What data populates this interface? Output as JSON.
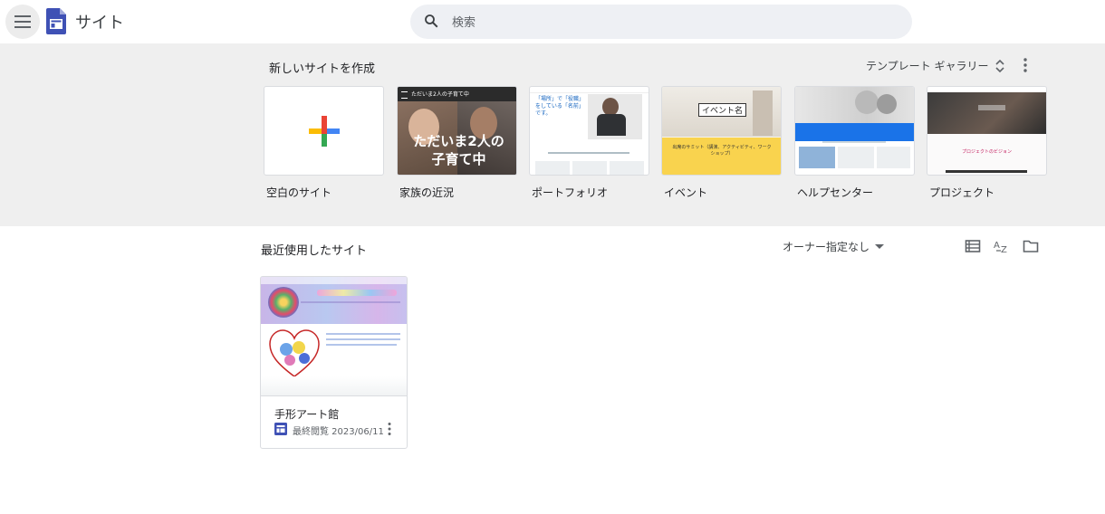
{
  "header": {
    "app_title": "サイト",
    "search_placeholder": "検索"
  },
  "gallery": {
    "title": "新しいサイトを作成",
    "toggle_label": "テンプレート ギャラリー",
    "templates": [
      {
        "label": "空白のサイト"
      },
      {
        "label": "家族の近況",
        "thumb_text_bar": "ただいま2人の子育て中",
        "thumb_text_big": "ただいま2人の子育て中"
      },
      {
        "label": "ポートフォリオ",
        "thumb_text": "「場所」で「役職」をしている「名前」です。"
      },
      {
        "label": "イベント",
        "thumb_text": "イベント名",
        "thumb_text_small": "出席のサミット（講演、アクティビティ、ワークショップ）"
      },
      {
        "label": "ヘルプセンター"
      },
      {
        "label": "プロジェクト",
        "thumb_text": "プロジェクトのビジョン"
      }
    ]
  },
  "recent": {
    "title": "最近使用したサイト",
    "owner_filter": "オーナー指定なし",
    "sites": [
      {
        "name": "手形アート館",
        "last_viewed": "最終閲覧 2023/06/11"
      }
    ]
  },
  "colors": {
    "plus_red": "#ea4335",
    "plus_blue": "#4285f4",
    "plus_yellow": "#fbbc04",
    "plus_green": "#34a853",
    "sites_brand": "#3f51b5",
    "event_yellow": "#f9d34e",
    "help_blue": "#1a73e8"
  },
  "icons": {
    "menu": "hamburger-menu-icon",
    "logo": "google-sites-logo",
    "search": "search-icon",
    "gallery_toggle": "unfold-more-icon",
    "more": "more-vert-icon",
    "list_view": "list-view-icon",
    "sort": "sort-az-icon",
    "folder": "folder-icon",
    "site": "sites-doc-icon"
  }
}
